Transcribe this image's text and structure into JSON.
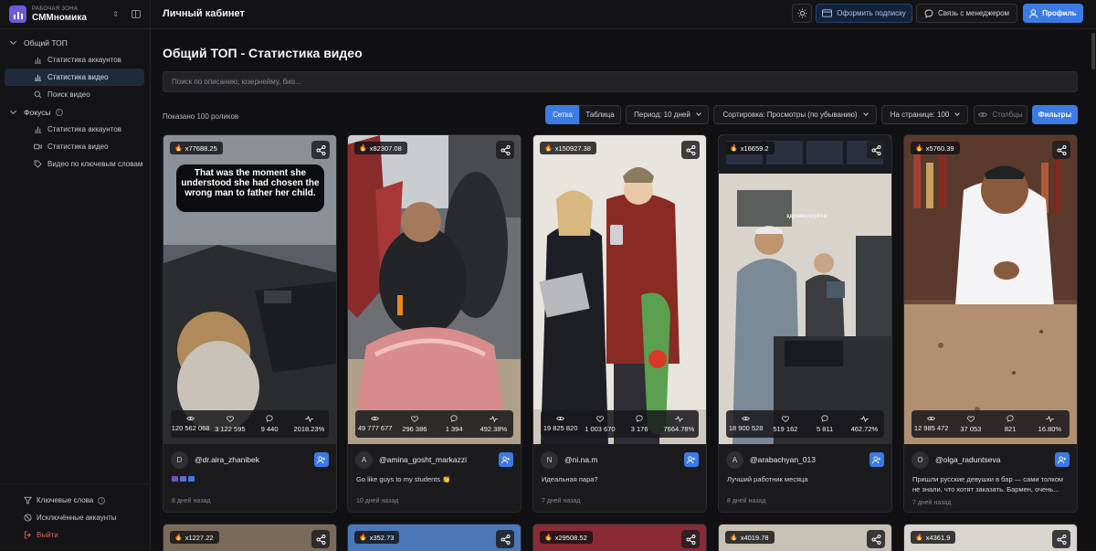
{
  "workspace": {
    "label": "РАБОЧАЯ ЗОНА",
    "name": "СММномика"
  },
  "sidebar": {
    "groups": [
      {
        "label": "Общий ТОП",
        "items": [
          {
            "label": "Статистика аккаунтов",
            "icon": "bar-chart-icon"
          },
          {
            "label": "Статистика видео",
            "icon": "video-icon",
            "active": true
          },
          {
            "label": "Поиск видео",
            "icon": "search-icon"
          }
        ]
      },
      {
        "label": "Фокусы",
        "items": [
          {
            "label": "Статистика аккаунтов",
            "icon": "bar-chart-icon"
          },
          {
            "label": "Статистика видео",
            "icon": "video-icon"
          },
          {
            "label": "Видео по ключевым словам",
            "icon": "tag-icon"
          }
        ]
      }
    ],
    "bottom": [
      {
        "label": "Ключевые слова",
        "icon": "filter-icon"
      },
      {
        "label": "Исключённые аккаунты",
        "icon": "ban-icon"
      },
      {
        "label": "Выйти",
        "icon": "logout-icon"
      }
    ]
  },
  "header": {
    "title": "Личный кабинет",
    "subscribe": "Оформить подписку",
    "manager": "Связь с менеджером",
    "profile": "Профиль"
  },
  "main": {
    "title": "Общий ТОП - Статистика видео",
    "search_placeholder": "Поиск по описанию, юзернейму, био...",
    "count": "Показано 100 роликов",
    "toolbar": {
      "grid": "Сетка",
      "table": "Таблица",
      "period": "Период: 10 дней",
      "sort": "Сортировка: Просмотры (по убыванию)",
      "per_page": "На странице: 100",
      "columns": "Столбцы",
      "filters": "Фильтры"
    }
  },
  "cards": [
    {
      "multiplier": "x77688.25",
      "views": "120 562 068",
      "likes": "3 122 595",
      "comments": "9 440",
      "er": "2018.23%",
      "avatar": "D",
      "username": "@dr.aira_zhanibek",
      "description": "",
      "date": "8 дней назад",
      "overlay_text": "That was the moment she understood she had chosen the wrong man to father her child."
    },
    {
      "multiplier": "x82307.08",
      "views": "49 777 677",
      "likes": "296 386",
      "comments": "1 394",
      "er": "492.38%",
      "avatar": "A",
      "username": "@amina_gosht_markazzi",
      "description": "Go like guys to my students 👏",
      "date": "10 дней назад"
    },
    {
      "multiplier": "x150927.38",
      "views": "19 825 820",
      "likes": "1 003 670",
      "comments": "3 176",
      "er": "7664.78%",
      "avatar": "N",
      "username": "@ni.na.m",
      "description": "Идеальная пара?",
      "date": "7 дней назад"
    },
    {
      "multiplier": "x16659.2",
      "views": "18 900 528",
      "likes": "519 162",
      "comments": "5 811",
      "er": "462.72%",
      "avatar": "A",
      "username": "@arabachyan_013",
      "description": "Лучший работник месяца",
      "date": "8 дней назад",
      "overlay_text": "здравствуйте"
    },
    {
      "multiplier": "x5760.39",
      "views": "12 985 472",
      "likes": "37 053",
      "comments": "821",
      "er": "16.80%",
      "avatar": "O",
      "username": "@olga_raduntseva",
      "description": "Пришли русские девушки в бар — сами толком не знали, что хотят заказать. Бармен, очень...",
      "date": "7 дней назад"
    }
  ],
  "cards_row2": [
    {
      "multiplier": "x1227.22"
    },
    {
      "multiplier": "x352.73"
    },
    {
      "multiplier": "x29508.52"
    },
    {
      "multiplier": "x4019.78"
    },
    {
      "multiplier": "x4361.9"
    }
  ]
}
